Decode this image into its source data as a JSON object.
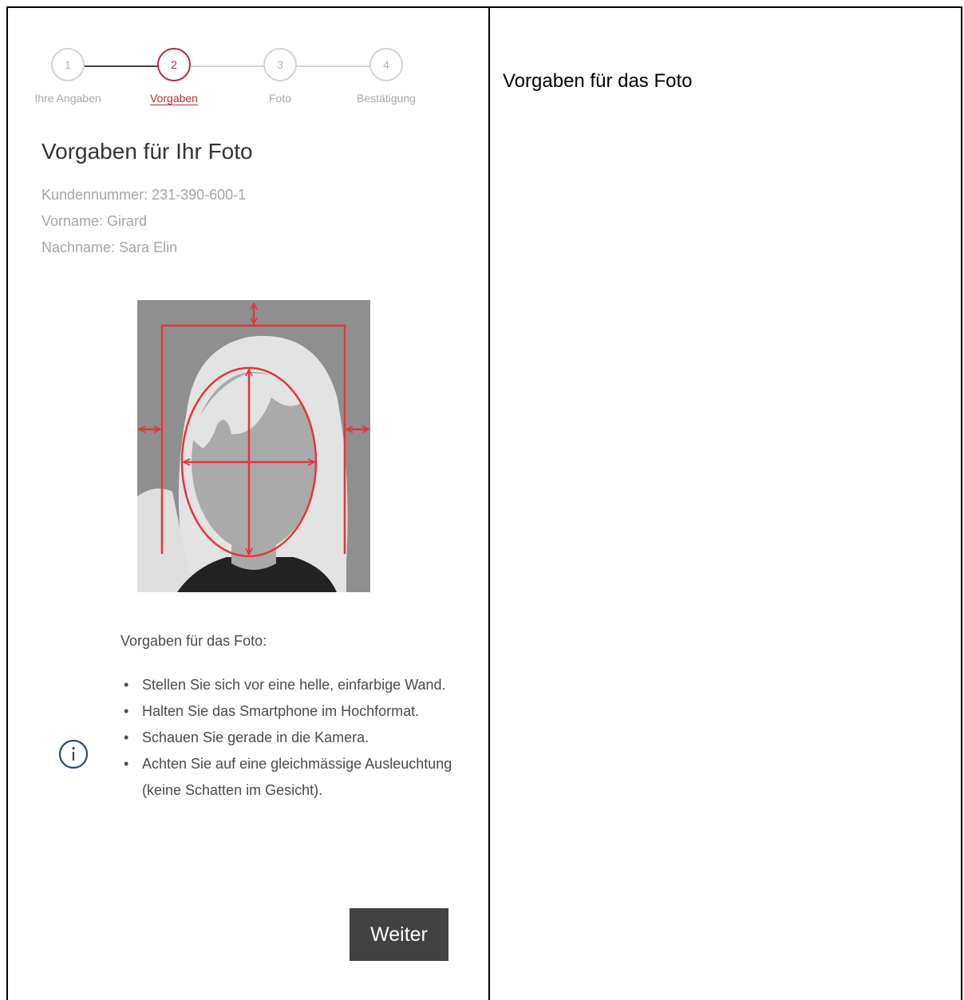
{
  "stepper": {
    "steps": [
      {
        "number": "1",
        "label": "Ihre Angaben"
      },
      {
        "number": "2",
        "label": "Vorgaben"
      },
      {
        "number": "3",
        "label": "Foto"
      },
      {
        "number": "4",
        "label": "Bestätigung"
      }
    ],
    "active_step": 2
  },
  "page": {
    "title": "Vorgaben für Ihr Foto",
    "customer_number": "Kundennummer: 231-390-600-1",
    "first_name": "Vorname: Girard",
    "last_name": "Nachname: Sara Elin"
  },
  "requirements": {
    "title": "Vorgaben für das Foto:",
    "items": [
      "Stellen Sie sich vor eine helle, einfarbige Wand.",
      "Halten Sie das Smartphone im Hochformat.",
      "Schauen Sie gerade in die Kamera.",
      "Achten Sie auf eine gleichmässige Ausleuchtung (keine Schatten im Gesicht)."
    ]
  },
  "actions": {
    "next_label": "Weiter"
  },
  "right_panel": {
    "heading": "Vorgaben für das Foto"
  },
  "colors": {
    "accent": "#b0303a",
    "guide_red": "#e8323c",
    "button_bg": "#424242"
  },
  "icons": {
    "info": "info-circle-icon"
  }
}
